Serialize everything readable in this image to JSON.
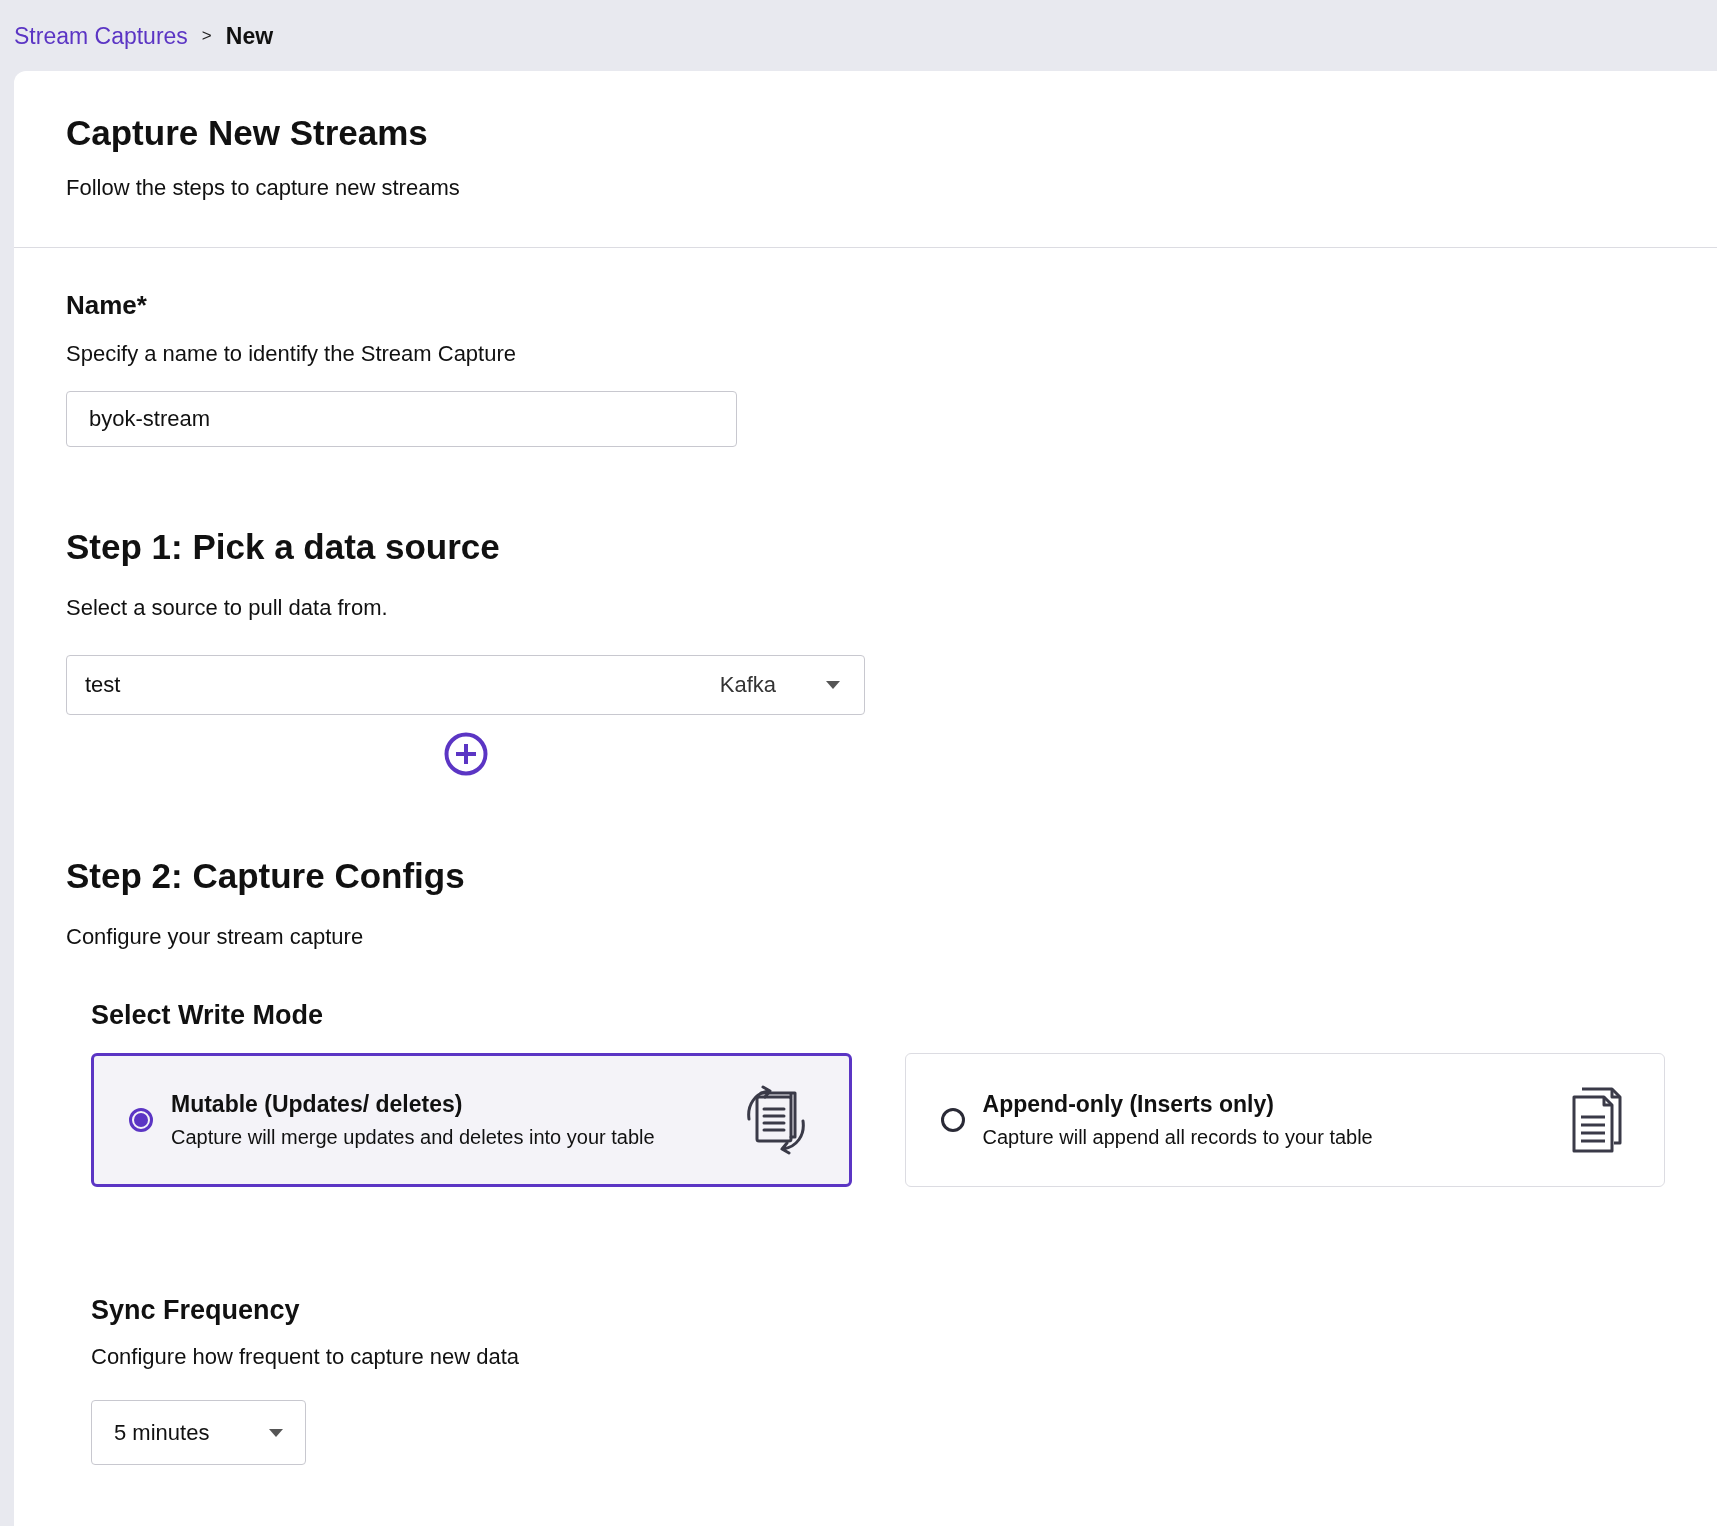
{
  "breadcrumb": {
    "link": "Stream Captures",
    "separator": ">",
    "current": "New"
  },
  "header": {
    "title": "Capture New Streams",
    "subtitle": "Follow the steps to capture new streams"
  },
  "name_section": {
    "heading": "Name*",
    "description": "Specify a name to identify the Stream Capture",
    "value": "byok-stream"
  },
  "step1": {
    "heading": "Step 1: Pick a data source",
    "description": "Select a source to pull data from.",
    "source": {
      "value": "test",
      "type": "Kafka"
    }
  },
  "step2": {
    "heading": "Step 2: Capture Configs",
    "description": "Configure your stream capture",
    "write_mode": {
      "heading": "Select Write Mode",
      "options": [
        {
          "kind": "mutable",
          "title": "Mutable (Updates/ deletes)",
          "description": "Capture will merge updates and deletes into your table",
          "selected": true
        },
        {
          "kind": "append",
          "title": "Append-only (Inserts only)",
          "description": "Capture will append all records to your table",
          "selected": false
        }
      ]
    },
    "sync_frequency": {
      "heading": "Sync Frequency",
      "description": "Configure how frequent to capture new data",
      "value": "5 minutes"
    }
  }
}
